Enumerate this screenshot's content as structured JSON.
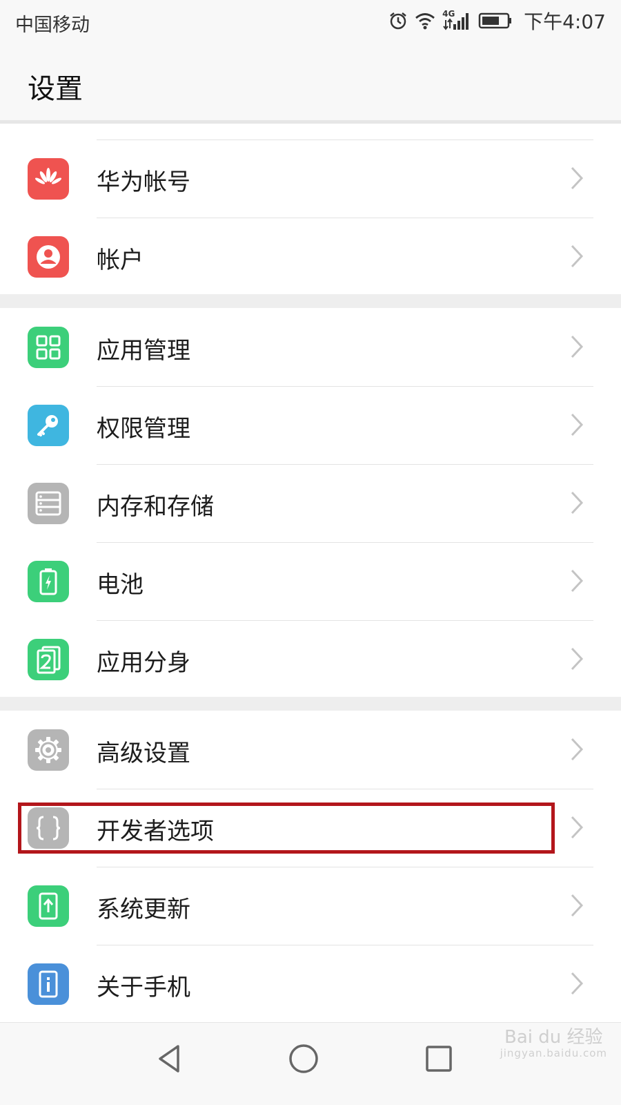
{
  "status_bar": {
    "carrier": "中国移动",
    "network_label": "4G",
    "time": "下午4:07"
  },
  "header": {
    "title": "设置"
  },
  "groups": [
    {
      "items": [
        {
          "label": "华为帐号",
          "icon": "huawei-logo-icon",
          "color": "#ef5350"
        },
        {
          "label": "帐户",
          "icon": "account-person-icon",
          "color": "#ef5350"
        }
      ]
    },
    {
      "items": [
        {
          "label": "应用管理",
          "icon": "app-grid-icon",
          "color": "#3ccf7a"
        },
        {
          "label": "权限管理",
          "icon": "key-icon",
          "color": "#3fb6e0"
        },
        {
          "label": "内存和存储",
          "icon": "storage-icon",
          "color": "#b5b5b5"
        },
        {
          "label": "电池",
          "icon": "battery-icon",
          "color": "#3ccf7a"
        },
        {
          "label": "应用分身",
          "icon": "app-twin-icon",
          "color": "#3ccf7a"
        }
      ]
    },
    {
      "items": [
        {
          "label": "高级设置",
          "icon": "gear-icon",
          "color": "#b5b5b5"
        },
        {
          "label": "开发者选项",
          "icon": "braces-icon",
          "color": "#b5b5b5",
          "highlighted": true
        },
        {
          "label": "系统更新",
          "icon": "system-update-icon",
          "color": "#3ccf7a"
        },
        {
          "label": "关于手机",
          "icon": "about-phone-icon",
          "color": "#4a90d9"
        }
      ]
    }
  ],
  "nav_bar": {
    "back": "back-triangle-icon",
    "home": "home-circle-icon",
    "recents": "recents-square-icon"
  },
  "watermark": {
    "text": "Bai du 经验",
    "sub": "jingyan.baidu.com"
  },
  "colors": {
    "highlight": "#b3161b"
  }
}
